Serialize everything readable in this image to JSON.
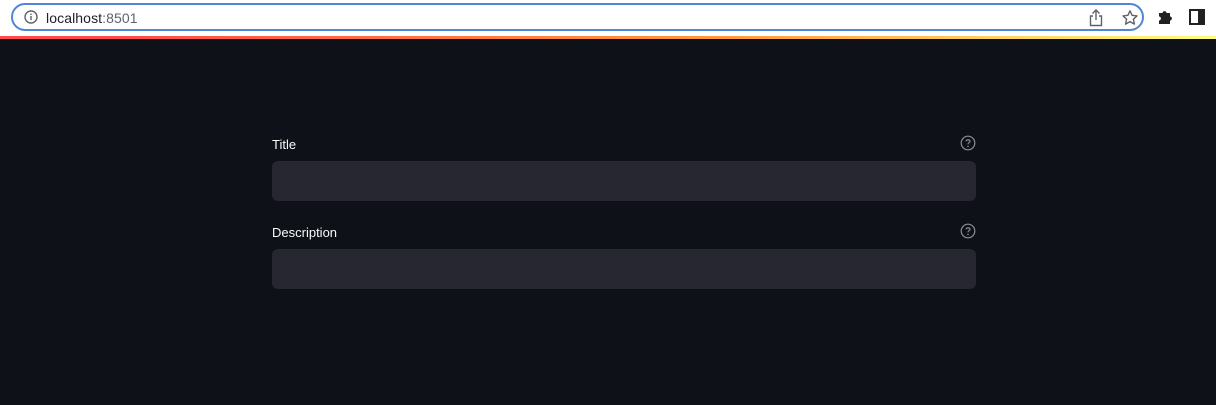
{
  "browser": {
    "url_host": "localhost",
    "url_port": ":8501",
    "icons": {
      "info": "info-icon",
      "share": "share-icon",
      "bookmark": "star-icon",
      "extensions": "puzzle-icon",
      "side_panel": "side-panel-icon"
    }
  },
  "form": {
    "fields": [
      {
        "label": "Title",
        "value": "",
        "help_icon": "help-icon"
      },
      {
        "label": "Description",
        "value": "",
        "help_icon": "help-icon"
      }
    ]
  },
  "colors": {
    "background": "#0e1117",
    "input_background": "#262730",
    "text": "#fafafa",
    "help_icon": "#8b8d93",
    "address_border": "#4f86d8",
    "decoration_start": "#ff4b4b",
    "decoration_end": "#fffd80"
  }
}
